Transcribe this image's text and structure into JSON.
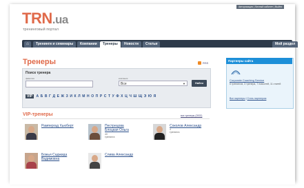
{
  "header": {
    "top_links": {
      "register": "Авторизация",
      "sep1": " | ",
      "personal": "Личный кабинет",
      "sep2": " | ",
      "logout": "Выйти"
    },
    "logo_main": "TRN",
    "logo_suffix": ".ua",
    "tagline": "тренинговый портал"
  },
  "nav": {
    "home_icon": "home-icon",
    "items": [
      {
        "label": "Тренинги и семинары"
      },
      {
        "label": "Компании"
      },
      {
        "label": "Тренеры",
        "active": true
      },
      {
        "label": "Новости"
      },
      {
        "label": "Статьи"
      }
    ],
    "my_section": "Мой раздел"
  },
  "main": {
    "title": "Тренеры",
    "rss": "RSS",
    "search": {
      "title": "Поиск тренера",
      "name_label": "фамилия",
      "name_value": "",
      "company_label": "компания",
      "company_value": "Все",
      "button": "Найти"
    },
    "alphabet": {
      "vip": "VIP",
      "letters": [
        "А",
        "Б",
        "В",
        "Г",
        "Д",
        "Е",
        "Ж",
        "З",
        "И",
        "К",
        "Л",
        "М",
        "Н",
        "О",
        "П",
        "Р",
        "С",
        "Т",
        "У",
        "Ф",
        "Х",
        "Ц",
        "Ч",
        "Ш",
        "Щ",
        "Э",
        "Ю",
        "Я"
      ]
    },
    "vip": {
      "title": "VIP-тренеры",
      "all_link": "все тренеры (2002)",
      "trainers": [
        {
          "name": "Рампергад Хьюберт",
          "sub": ""
        },
        {
          "name": "Пестрецова Блоцкая Ольга",
          "sub": "40 тренинга"
        },
        {
          "name": "Соколов Александр",
          "sub": "4 тренинга"
        },
        {
          "name": "Божья Саджида Вадимовна",
          "sub": ""
        },
        {
          "name": "Слива Александр",
          "sub": ""
        }
      ]
    }
  },
  "sidebar": {
    "partners": {
      "title": "Партнеры сайта",
      "name": "Corporate Coaching Service",
      "desc": "6 тренингов, 3 тренера, 7 новостей, 11 статей",
      "link_all": "Все партнеры",
      "link_sep": " | ",
      "link_become": "Стать партнером"
    }
  }
}
